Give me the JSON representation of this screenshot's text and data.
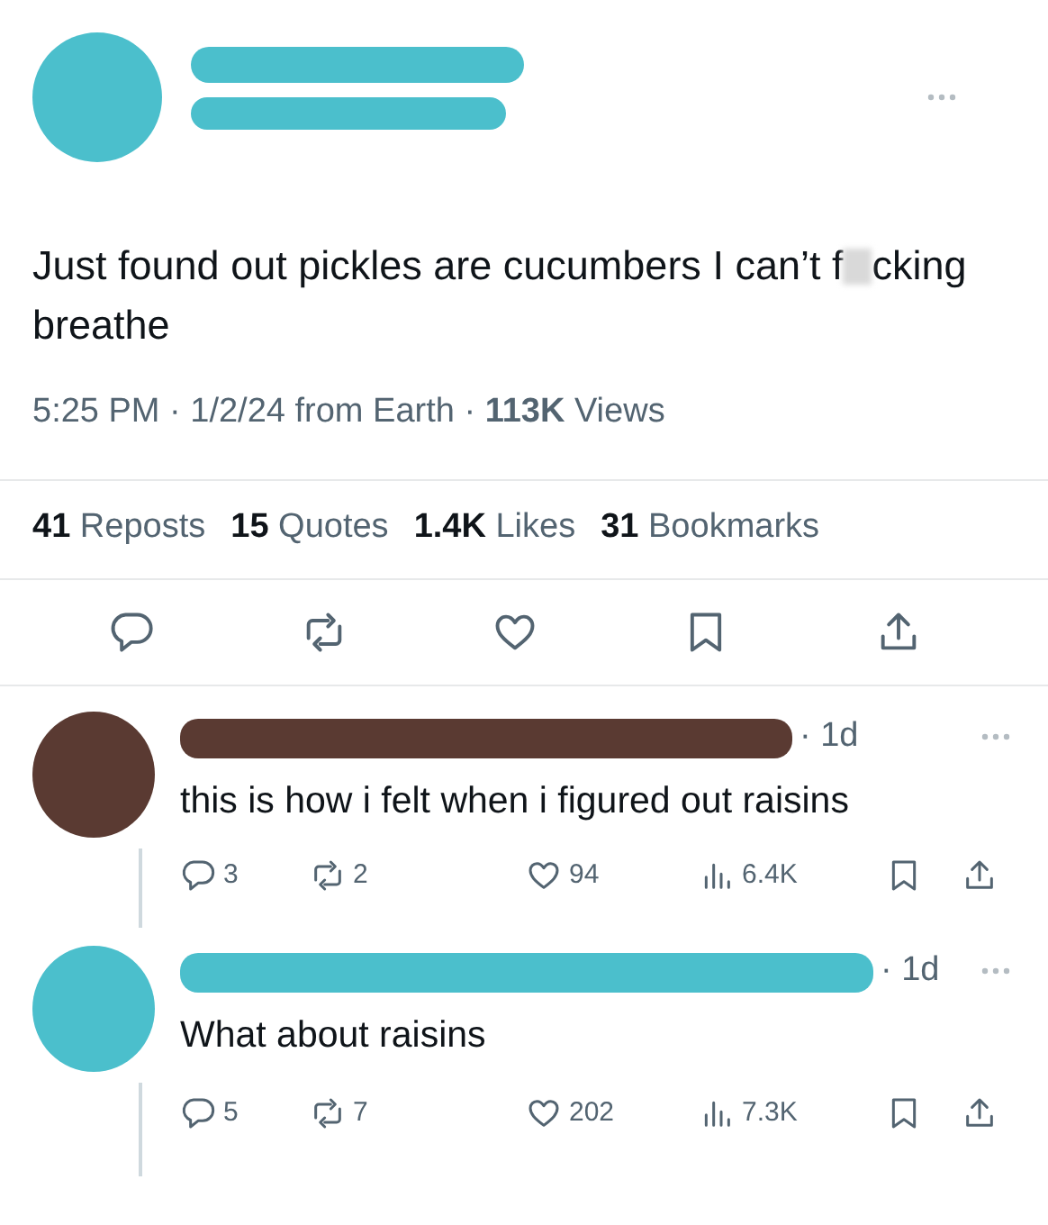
{
  "post": {
    "text_before_blur": "Just found out pickles are cucumbers I can’t f",
    "text_after_blur": "cking breathe",
    "meta": "5:25 PM · 1/2/24 from Earth · **113K** Views",
    "stats": [
      "**41** Reposts",
      "**15** Quotes",
      "**1.4K** Likes",
      "**31** Bookmarks"
    ]
  },
  "replies": [
    {
      "color": "#5a3a32",
      "age": "· 1d",
      "text": "this is how i felt when i figured out raisins",
      "replies": "3",
      "reposts": "2",
      "likes": "94",
      "views": "6.4K"
    },
    {
      "color": "#4bbfcc",
      "age": "· 1d",
      "text": "What about raisins",
      "replies": "5",
      "reposts": "7",
      "likes": "202",
      "views": "7.3K"
    }
  ]
}
